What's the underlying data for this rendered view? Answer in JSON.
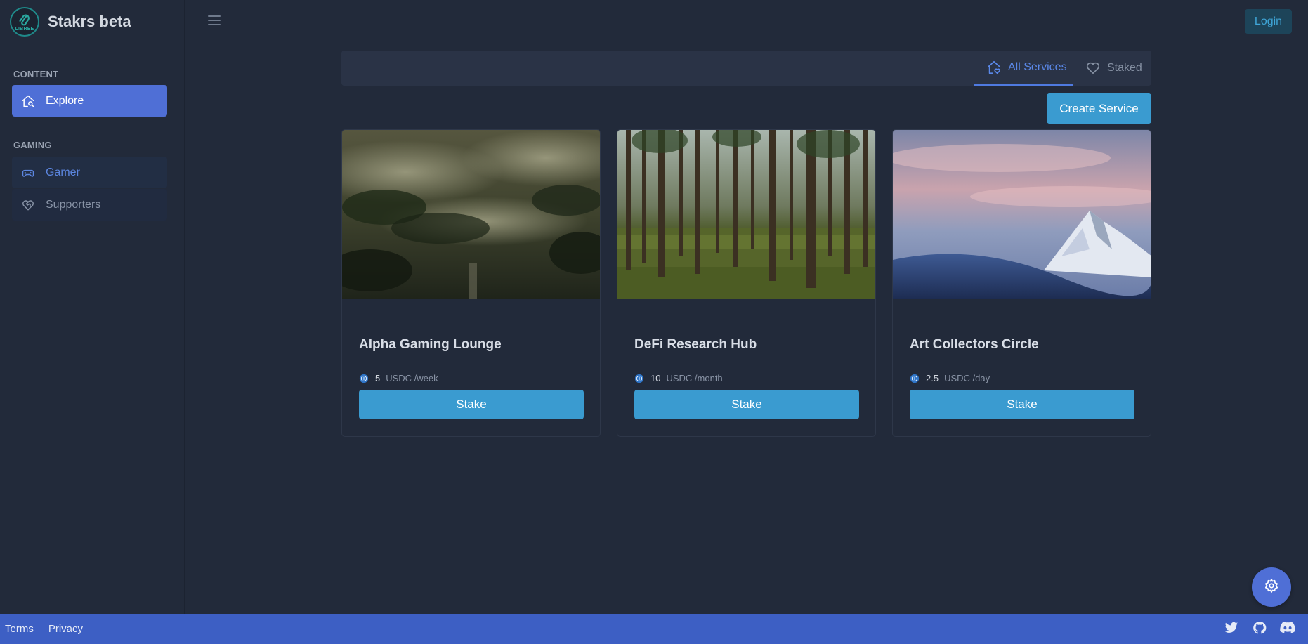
{
  "brand": {
    "name": "Stakrs beta",
    "logo_text": "LIBREE"
  },
  "header": {
    "login_label": "Login"
  },
  "sidebar": {
    "sections": [
      {
        "label": "CONTENT",
        "items": [
          {
            "label": "Explore",
            "icon": "home-search-icon"
          }
        ]
      },
      {
        "label": "GAMING",
        "items": [
          {
            "label": "Gamer",
            "icon": "gamepad-icon"
          },
          {
            "label": "Supporters",
            "icon": "heart-handshake-icon"
          }
        ]
      }
    ]
  },
  "tabs": [
    {
      "label": "All Services",
      "icon": "home-heart-icon",
      "active": true
    },
    {
      "label": "Staked",
      "icon": "heart-icon",
      "active": false
    }
  ],
  "create_label": "Create Service",
  "cards": [
    {
      "title": "Alpha Gaming Lounge",
      "amount": "5",
      "unit": "USDC /week",
      "button": "Stake"
    },
    {
      "title": "DeFi Research Hub",
      "amount": "10",
      "unit": "USDC /month",
      "button": "Stake"
    },
    {
      "title": "Art Collectors Circle",
      "amount": "2.5",
      "unit": "USDC /day",
      "button": "Stake"
    }
  ],
  "footer": {
    "links": [
      "Terms",
      "Privacy"
    ],
    "icons": [
      "twitter-icon",
      "github-icon",
      "discord-icon"
    ]
  },
  "colors": {
    "accent": "#4f6fd6",
    "button": "#3a9bd0",
    "background": "#222a3a",
    "footer": "#3d5fc4"
  }
}
